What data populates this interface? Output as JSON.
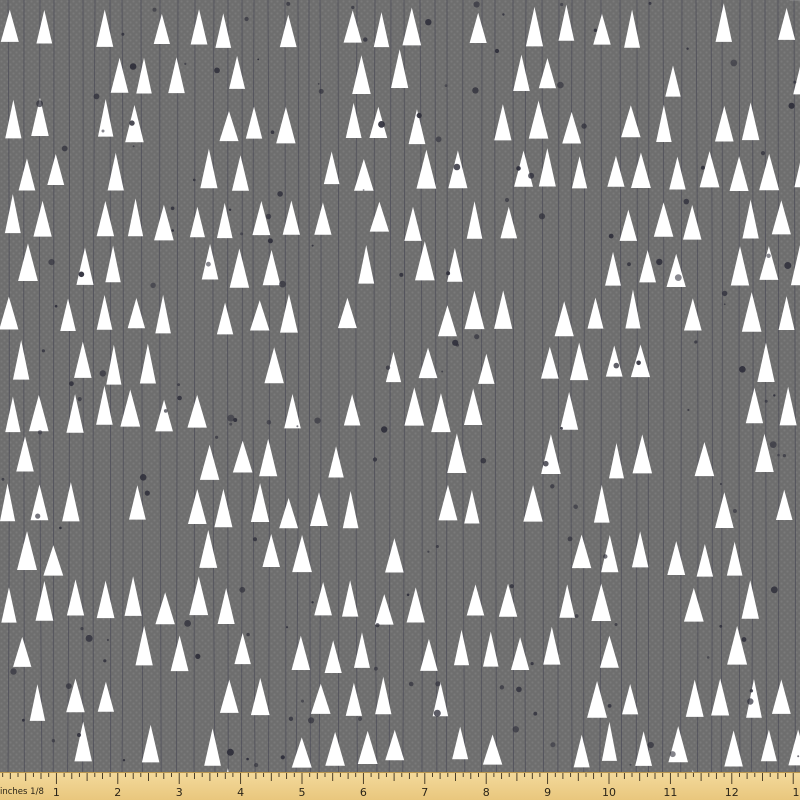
{
  "fabric": {
    "background_color": "#6e6e6e",
    "weave_color": "#7a7a7a",
    "line_color": "#4a4a55",
    "triangle_color": "#ffffff",
    "speckle_color": "#2e2e3a",
    "motif": "white triangles with thin vertical lines and dark speckles on gray woven texture"
  },
  "ruler": {
    "unit_label": "inches 1/8",
    "numbers": [
      "1",
      "2",
      "3",
      "4",
      "5",
      "6",
      "7",
      "8",
      "9",
      "10",
      "11",
      "12",
      "1"
    ],
    "color": "#efd08c",
    "tick_color": "#3a2f1d"
  }
}
